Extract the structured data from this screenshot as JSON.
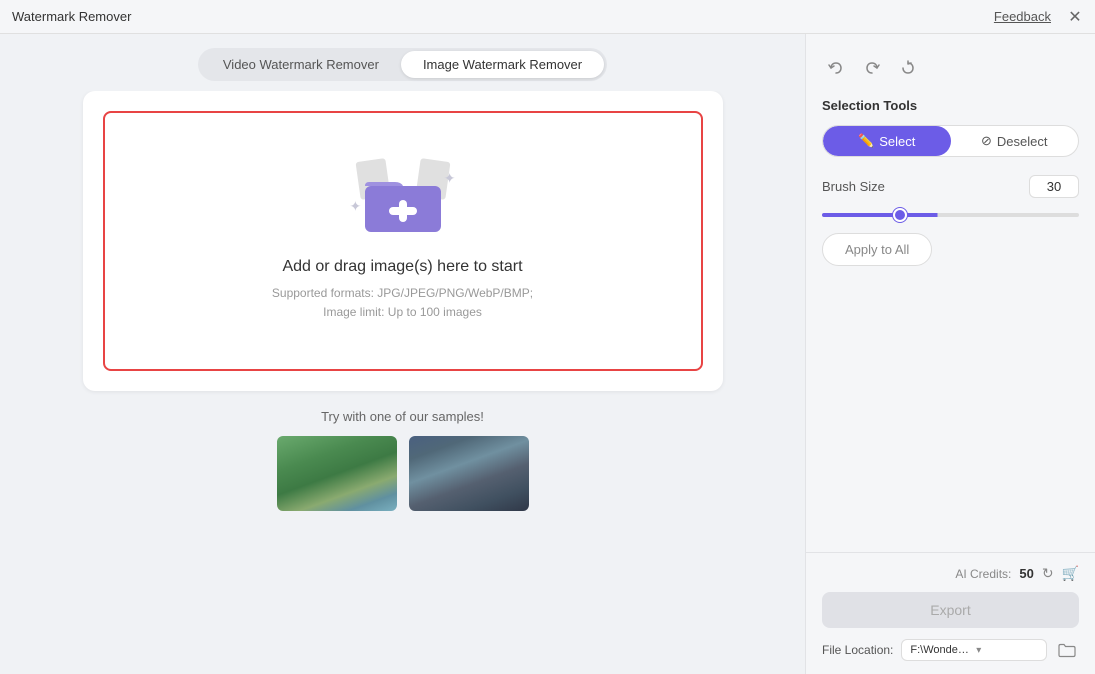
{
  "titleBar": {
    "appTitle": "Watermark Remover",
    "feedbackLabel": "Feedback",
    "closeIcon": "✕"
  },
  "tabs": [
    {
      "id": "video",
      "label": "Video Watermark Remover",
      "active": false
    },
    {
      "id": "image",
      "label": "Image Watermark Remover",
      "active": true
    }
  ],
  "dropZone": {
    "title": "Add or drag image(s) here to start",
    "subLine1": "Supported formats: JPG/JPEG/PNG/WebP/BMP;",
    "subLine2": "Image limit: Up to 100 images"
  },
  "samples": {
    "label": "Try with one of our samples!"
  },
  "rightPanel": {
    "selectionToolsTitle": "Selection Tools",
    "selectLabel": "Select",
    "deselectLabel": "Deselect",
    "brushSizeLabel": "Brush Size",
    "brushSizeValue": "30",
    "applyToAllLabel": "Apply to All"
  },
  "bottomPanel": {
    "creditsLabel": "AI Credits:",
    "creditsValue": "50",
    "exportLabel": "Export",
    "fileLocationLabel": "File Location:",
    "fileLocationPath": "F:\\Wondershare UniCon"
  },
  "icons": {
    "undo": "↩",
    "redo": "↪",
    "rotate": "↻",
    "pencil": "✏",
    "eraser": "⊘",
    "refresh": "↻",
    "cart": "🛒",
    "dropdown": "▾",
    "folderOpen": "📁"
  }
}
